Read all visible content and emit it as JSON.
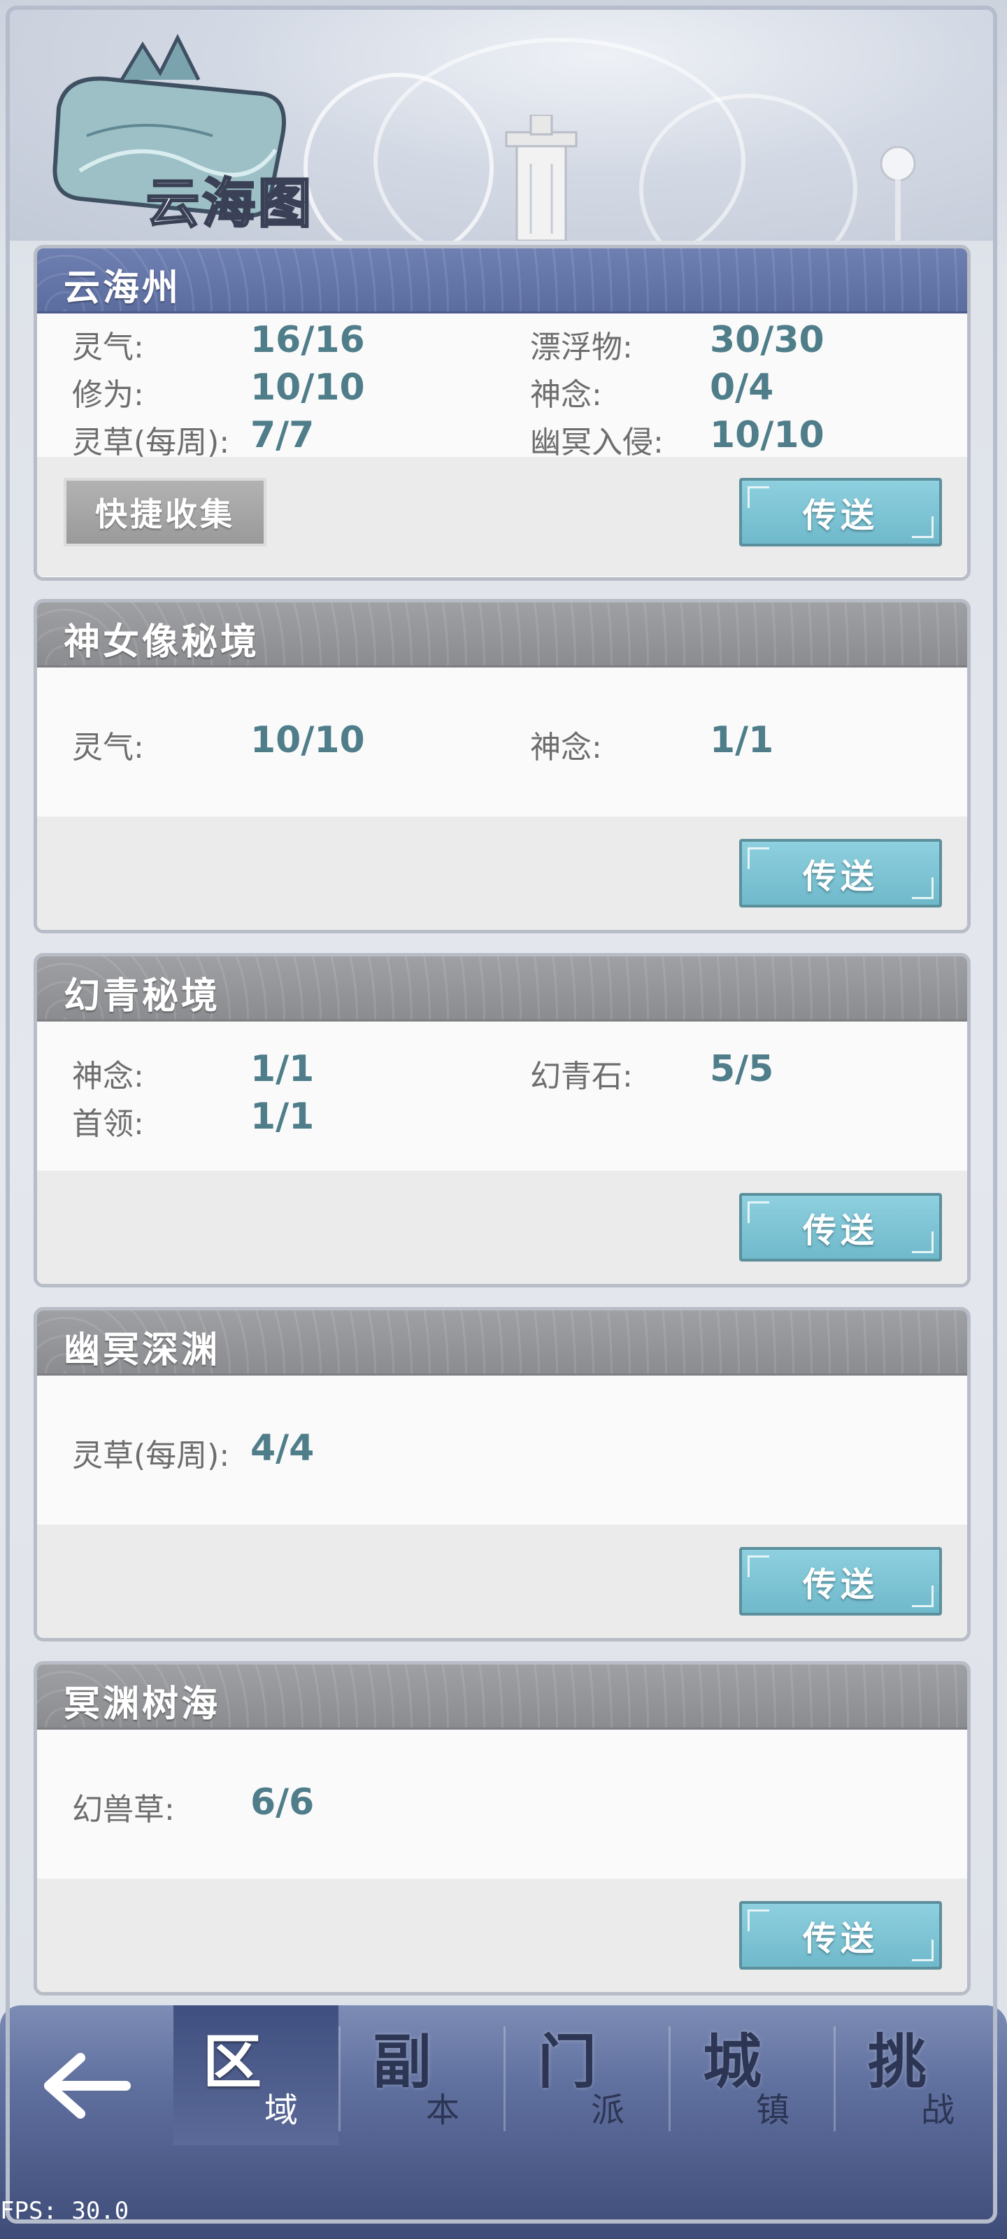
{
  "header": {
    "title": "云海图"
  },
  "cards": [
    {
      "title": "云海州",
      "stats": [
        {
          "label": "灵气:",
          "value": "16/16"
        },
        {
          "label": "漂浮物:",
          "value": "30/30"
        },
        {
          "label": "修为:",
          "value": "10/10"
        },
        {
          "label": "神念:",
          "value": "0/4"
        },
        {
          "label": "灵草(每周):",
          "value": "7/7"
        },
        {
          "label": "幽冥入侵:",
          "value": "10/10"
        }
      ],
      "collect_label": "快捷收集",
      "teleport_label": "传送"
    },
    {
      "title": "神女像秘境",
      "stats": [
        {
          "label": "灵气:",
          "value": "10/10"
        },
        {
          "label": "神念:",
          "value": "1/1"
        }
      ],
      "teleport_label": "传送"
    },
    {
      "title": "幻青秘境",
      "stats": [
        {
          "label": "神念:",
          "value": "1/1"
        },
        {
          "label": "幻青石:",
          "value": "5/5"
        },
        {
          "label": "首领:",
          "value": "1/1"
        }
      ],
      "teleport_label": "传送"
    },
    {
      "title": "幽冥深渊",
      "stats": [
        {
          "label": "灵草(每周):",
          "value": "4/4"
        }
      ],
      "teleport_label": "传送"
    },
    {
      "title": "冥渊树海",
      "stats": [
        {
          "label": "幻兽草:",
          "value": "6/6"
        }
      ],
      "teleport_label": "传送"
    }
  ],
  "nav": {
    "tabs": [
      {
        "big": "区",
        "small": "域",
        "active": true
      },
      {
        "big": "副",
        "small": "本"
      },
      {
        "big": "门",
        "small": "派"
      },
      {
        "big": "城",
        "small": "镇"
      },
      {
        "big": "挑",
        "small": "战"
      }
    ]
  },
  "fps": "FPS: 30.0",
  "colors": {
    "accent_teal": "#6fb9cb",
    "value_text": "#4f7d8a",
    "active_header": "#5b6c9f",
    "nav_bg": "#5f6f9e"
  }
}
